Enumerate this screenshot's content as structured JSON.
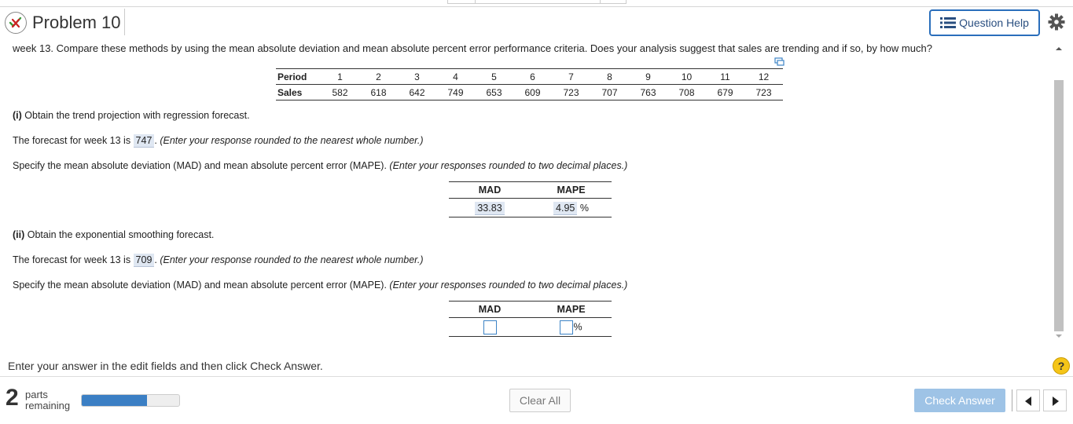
{
  "header": {
    "title": "Problem 10",
    "question_help_label": "Question Help"
  },
  "question": {
    "text": "week 13. Compare these methods by using the mean absolute deviation and mean absolute percent error performance criteria. Does your analysis suggest that sales are trending and if so, by how much?"
  },
  "data_table": {
    "period_label": "Period",
    "sales_label": "Sales",
    "periods": [
      "1",
      "2",
      "3",
      "4",
      "5",
      "6",
      "7",
      "8",
      "9",
      "10",
      "11",
      "12"
    ],
    "sales": [
      "582",
      "618",
      "642",
      "749",
      "653",
      "609",
      "723",
      "707",
      "763",
      "708",
      "679",
      "723"
    ]
  },
  "part1": {
    "heading_prefix": "(i)",
    "heading_text": " Obtain the trend projection with regression forecast.",
    "forecast_prefix": "The forecast for week 13 is ",
    "forecast_value": "747",
    "forecast_suffix": ". ",
    "forecast_hint": "(Enter your response rounded to the nearest whole number.)",
    "specify_text": "Specify the mean absolute deviation (MAD) and mean absolute percent error (MAPE). ",
    "specify_hint": "(Enter your responses rounded to two decimal places.)",
    "mad_label": "MAD",
    "mape_label": "MAPE",
    "mad_value": "33.83",
    "mape_value": "4.95",
    "percent_sign": "%"
  },
  "part2": {
    "heading_prefix": "(ii)",
    "heading_text": " Obtain the exponential smoothing forecast.",
    "forecast_prefix": "The forecast for week 13 is ",
    "forecast_value": "709",
    "forecast_suffix": ". ",
    "forecast_hint": "(Enter your response rounded to the nearest whole number.)",
    "specify_text": "Specify the mean absolute deviation (MAD) and mean absolute percent error (MAPE). ",
    "specify_hint": "(Enter your responses rounded to two decimal places.)",
    "mad_label": "MAD",
    "mape_label": "MAPE",
    "mad_value": "",
    "mape_value": "",
    "percent_sign": "%"
  },
  "footer": {
    "instruction": "Enter your answer in the edit fields and then click Check Answer.",
    "help_symbol": "?",
    "parts_count": "2",
    "parts_label_1": "parts",
    "parts_label_2": "remaining",
    "progress_fraction": 0.67,
    "clear_all_label": "Clear All",
    "check_answer_label": "Check Answer"
  },
  "colors": {
    "accent": "#2a6ebb",
    "check_button": "#9ec3e6",
    "progress_fill": "#3b7fc4",
    "answer_highlight": "#dfe7f2",
    "help_yellow": "#f5c518"
  },
  "icons": {
    "status": "partial-correct-icon",
    "question_help": "list-icon",
    "settings": "gear-icon",
    "expand": "expand-icon",
    "help": "question-mark-icon",
    "prev": "arrow-left-icon",
    "next": "arrow-right-icon"
  }
}
